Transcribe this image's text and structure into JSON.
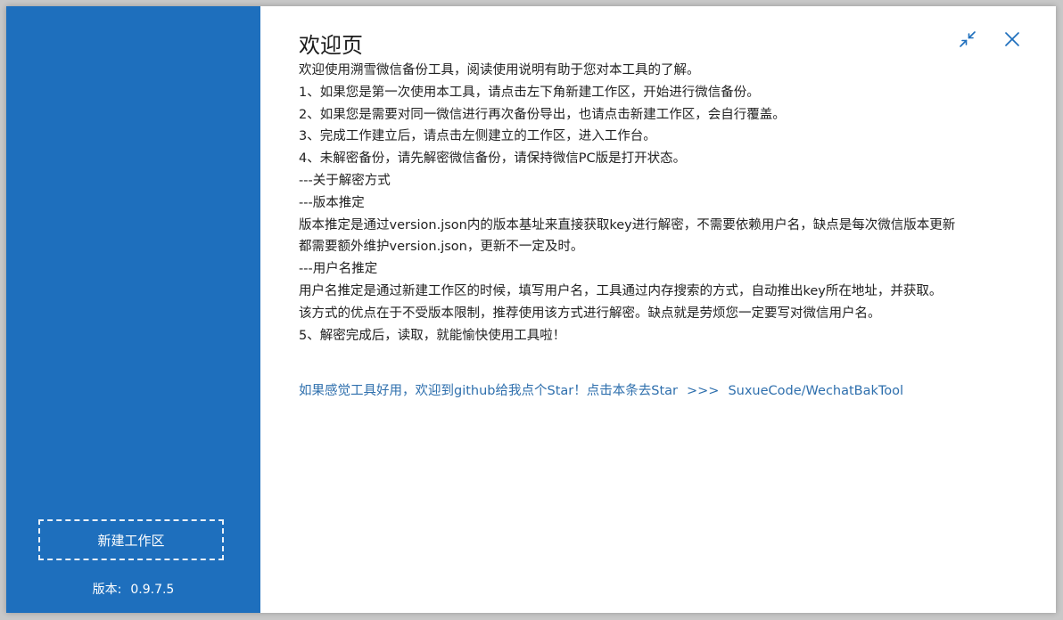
{
  "sidebar": {
    "new_workspace_label": "新建工作区",
    "version_label": "版本:",
    "version_value": "0.9.7.5"
  },
  "main": {
    "title": "欢迎页",
    "lines": [
      "欢迎使用溯雪微信备份工具，阅读使用说明有助于您对本工具的了解。",
      "1、如果您是第一次使用本工具，请点击左下角新建工作区，开始进行微信备份。",
      "2、如果您是需要对同一微信进行再次备份导出，也请点击新建工作区，会自行覆盖。",
      "3、完成工作建立后，请点击左侧建立的工作区，进入工作台。",
      "4、未解密备份，请先解密微信备份，请保持微信PC版是打开状态。",
      "---关于解密方式",
      "---版本推定",
      "版本推定是通过version.json内的版本基址来直接获取key进行解密，不需要依赖用户名，缺点是每次微信版本更新",
      "都需要额外维护version.json，更新不一定及时。",
      "---用户名推定",
      "用户名推定是通过新建工作区的时候，填写用户名，工具通过内存搜索的方式，自动推出key所在地址，并获取。",
      "该方式的优点在于不受版本限制，推荐使用该方式进行解密。缺点就是劳烦您一定要写对微信用户名。",
      "5、解密完成后，读取，就能愉快使用工具啦！"
    ],
    "star_link": {
      "text": "如果感觉工具好用，欢迎到github给我点个Star！点击本条去Star",
      "arrow": ">>>",
      "repo": "SuxueCode/WechatBakTool"
    }
  },
  "window_controls": {
    "collapse_icon": "collapse-arrows-icon",
    "close_icon": "close-x-icon"
  },
  "colors": {
    "sidebar_bg": "#1e6fbd",
    "link": "#2e6fad",
    "icon": "#1e6fbd"
  }
}
